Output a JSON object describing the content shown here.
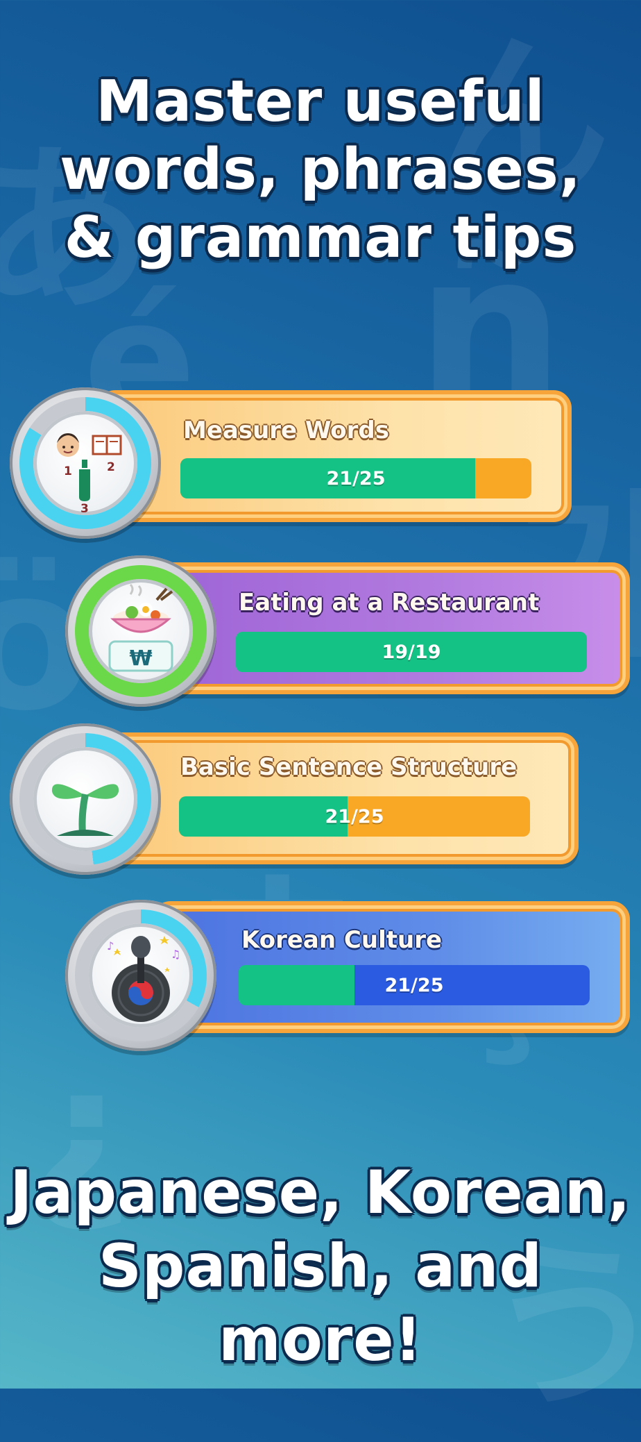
{
  "headline_top": [
    "Master useful",
    "words, phrases,",
    "& grammar tips"
  ],
  "headline_bottom": [
    "Japanese, Korean,",
    "Spanish, and more!"
  ],
  "colors": {
    "progress_fill": "#15c285",
    "orange_remaining": "#f9a825",
    "blue_remaining": "#2a5be0",
    "card_border": "#f7a53a"
  },
  "lessons": [
    {
      "title": "Measure Words",
      "progress_text": "21/25",
      "progress": 0.84,
      "icon": "people-book-bottle-count-icon",
      "theme": "orange"
    },
    {
      "title": "Eating at a Restaurant",
      "progress_text": "19/19",
      "progress": 1.0,
      "icon": "bibimbap-won-icon",
      "theme": "purple"
    },
    {
      "title": "Basic Sentence Structure",
      "progress_text": "21/25",
      "progress": 0.48,
      "icon": "sprout-icon",
      "theme": "orange"
    },
    {
      "title": "Korean Culture",
      "progress_text": "21/25",
      "progress": 0.33,
      "icon": "microphone-vinyl-icon",
      "theme": "blue"
    }
  ]
}
